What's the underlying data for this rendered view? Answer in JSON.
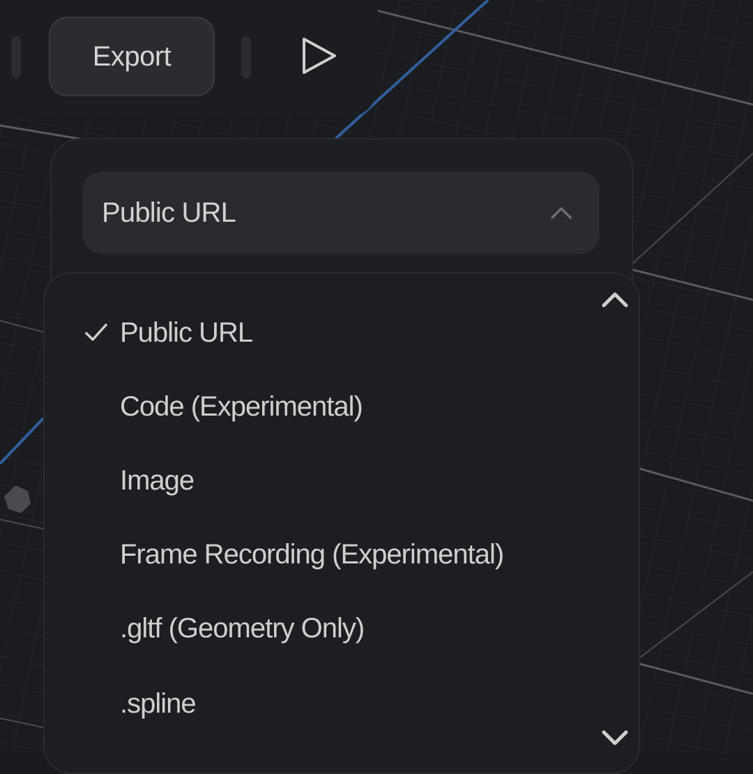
{
  "toolbar": {
    "export_label": "Export",
    "play_icon": "play-icon"
  },
  "export_panel": {
    "selected_value": "Public URL",
    "chevron_icon": "chevron-up-icon"
  },
  "dropdown": {
    "options": [
      {
        "label": "Public URL",
        "selected": true
      },
      {
        "label": "Code (Experimental)",
        "selected": false
      },
      {
        "label": "Image",
        "selected": false
      },
      {
        "label": "Frame Recording (Experimental)",
        "selected": false
      },
      {
        "label": ".gltf (Geometry Only)",
        "selected": false
      },
      {
        "label": ".spline",
        "selected": false
      }
    ],
    "scroll_up_icon": "chevron-up-icon",
    "scroll_down_icon": "chevron-down-icon",
    "check_icon": "check-icon"
  },
  "colors": {
    "background": "#1b1c20",
    "grid_line": "#2a2b30",
    "grid_major": "#55565b",
    "axis_blue": "#2f5f9c",
    "text": "#d2d2d4"
  }
}
